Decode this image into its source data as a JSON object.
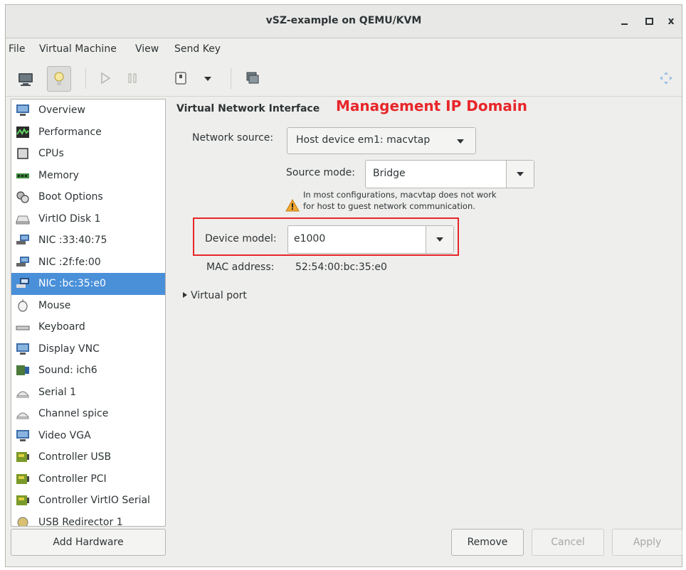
{
  "window": {
    "title": "vSZ-example on QEMU/KVM",
    "minimize": "_",
    "maximize": "□",
    "close": "x"
  },
  "menubar": [
    "File",
    "Virtual Machine",
    "View",
    "Send Key"
  ],
  "sidebar": {
    "items": [
      {
        "label": "Overview",
        "icon": "monitor-icon"
      },
      {
        "label": "Performance",
        "icon": "performance-graph-icon"
      },
      {
        "label": "CPUs",
        "icon": "cpu-chip-icon"
      },
      {
        "label": "Memory",
        "icon": "memory-module-icon"
      },
      {
        "label": "Boot Options",
        "icon": "boot-gears-icon"
      },
      {
        "label": "VirtIO Disk 1",
        "icon": "disk-icon"
      },
      {
        "label": "NIC :33:40:75",
        "icon": "network-card-icon"
      },
      {
        "label": "NIC :2f:fe:00",
        "icon": "network-card-icon"
      },
      {
        "label": "NIC :bc:35:e0",
        "icon": "network-card-icon",
        "selected": true
      },
      {
        "label": "Mouse",
        "icon": "mouse-icon"
      },
      {
        "label": "Keyboard",
        "icon": "keyboard-icon"
      },
      {
        "label": "Display VNC",
        "icon": "display-icon"
      },
      {
        "label": "Sound: ich6",
        "icon": "sound-card-icon"
      },
      {
        "label": "Serial 1",
        "icon": "serial-port-icon"
      },
      {
        "label": "Channel spice",
        "icon": "channel-icon"
      },
      {
        "label": "Video VGA",
        "icon": "video-monitor-icon"
      },
      {
        "label": "Controller USB",
        "icon": "controller-board-icon"
      },
      {
        "label": "Controller PCI",
        "icon": "controller-board-icon"
      },
      {
        "label": "Controller VirtIO Serial",
        "icon": "controller-board-icon"
      },
      {
        "label": "USB Redirector 1",
        "icon": "usb-redirector-icon"
      }
    ],
    "add_hardware": "Add Hardware"
  },
  "detail": {
    "heading": "Virtual Network Interface",
    "annotation": "Management IP Domain",
    "network_source_label": "Network source:",
    "network_source_value": "Host device em1: macvtap",
    "source_mode_label": "Source mode:",
    "source_mode_value": "Bridge",
    "warning_line1": "In most configurations, macvtap does not work",
    "warning_line2": "for host to guest network communication.",
    "device_model_label": "Device model:",
    "device_model_value": "e1000",
    "mac_label": "MAC address:",
    "mac_value": "52:54:00:bc:35:e0",
    "virtual_port": "Virtual port"
  },
  "buttons": {
    "remove": "Remove",
    "cancel": "Cancel",
    "apply": "Apply"
  },
  "colors": {
    "selection": "#4a90d9",
    "annotation": "#e8262a"
  }
}
